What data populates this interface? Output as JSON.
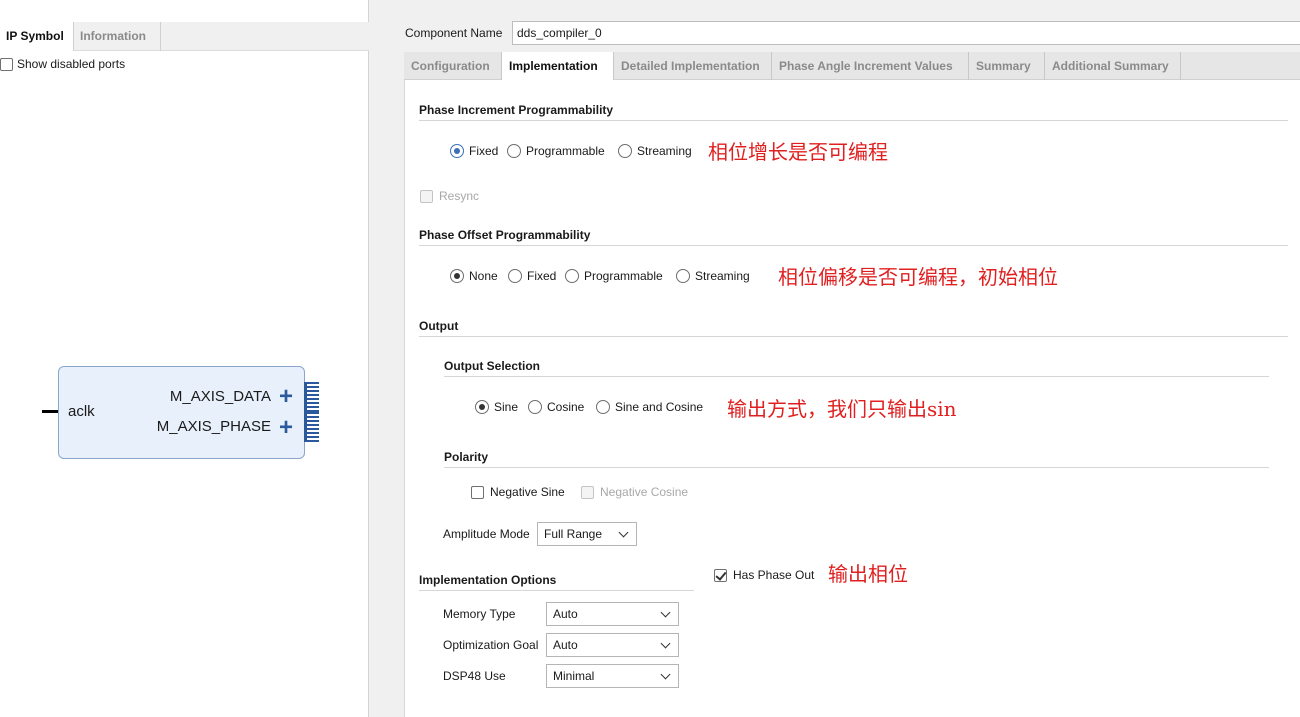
{
  "left": {
    "tabs": [
      "IP Symbol",
      "Information"
    ],
    "show_disabled_ports": "Show disabled ports",
    "ports": {
      "input": "aclk",
      "outputs": [
        "M_AXIS_DATA",
        "M_AXIS_PHASE"
      ]
    }
  },
  "component": {
    "label": "Component Name",
    "value": "dds_compiler_0"
  },
  "tabs": [
    "Configuration",
    "Implementation",
    "Detailed Implementation",
    "Phase Angle Increment Values",
    "Summary",
    "Additional Summary"
  ],
  "active_tab": "Implementation",
  "phase_increment": {
    "title": "Phase Increment Programmability",
    "options": [
      "Fixed",
      "Programmable",
      "Streaming"
    ],
    "selected": "Fixed",
    "note": "相位增长是否可编程",
    "resync": "Resync"
  },
  "phase_offset": {
    "title": "Phase Offset Programmability",
    "options": [
      "None",
      "Fixed",
      "Programmable",
      "Streaming"
    ],
    "selected": "None",
    "note": "相位偏移是否可编程，初始相位"
  },
  "output": {
    "title": "Output",
    "selection_title": "Output Selection",
    "selection_options": [
      "Sine",
      "Cosine",
      "Sine and Cosine"
    ],
    "selected": "Sine",
    "selection_note": "输出方式，我们只输出sin",
    "polarity_title": "Polarity",
    "negative_sine": "Negative Sine",
    "negative_cosine": "Negative Cosine",
    "amplitude_label": "Amplitude Mode",
    "amplitude_value": "Full Range"
  },
  "implementation": {
    "title": "Implementation Options",
    "has_phase_out": "Has Phase Out",
    "has_phase_out_checked": true,
    "phase_out_note": "输出相位",
    "memory_type_label": "Memory Type",
    "memory_type_value": "Auto",
    "optimization_goal_label": "Optimization Goal",
    "optimization_goal_value": "Auto",
    "dsp48_label": "DSP48 Use",
    "dsp48_value": "Minimal"
  },
  "colors": {
    "annotation": "#e02020",
    "block_fill": "#e8f0fb",
    "port_blue": "#2a5a9c"
  }
}
